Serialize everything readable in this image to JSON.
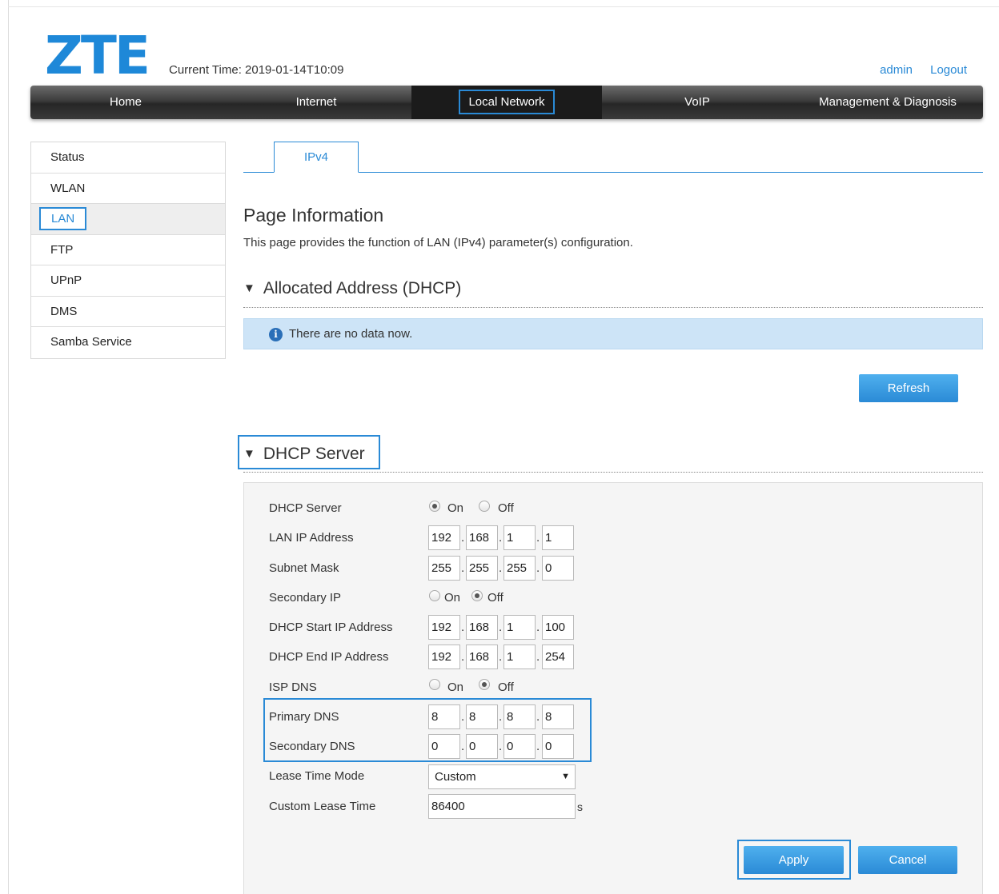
{
  "header": {
    "logo": "ZTE",
    "current_time": "Current Time: 2019-01-14T10:09",
    "user": "admin",
    "logout": "Logout"
  },
  "nav": [
    "Home",
    "Internet",
    "Local Network",
    "VoIP",
    "Management & Diagnosis"
  ],
  "nav_active": "Local Network",
  "sidebar": [
    "Status",
    "WLAN",
    "LAN",
    "FTP",
    "UPnP",
    "DMS",
    "Samba Service"
  ],
  "sidebar_active": "LAN",
  "tab": "IPv4",
  "page": {
    "title": "Page Information",
    "description": "This page provides the function of LAN (IPv4) parameter(s) configuration."
  },
  "allocated": {
    "title": "Allocated Address (DHCP)",
    "info": "There are no data now.",
    "refresh_label": "Refresh"
  },
  "dhcp": {
    "title": "DHCP Server",
    "on_label": "On",
    "off_label": "Off",
    "fields": {
      "server": {
        "label": "DHCP Server",
        "value": "On"
      },
      "lan_ip": {
        "label": "LAN IP Address",
        "octets": [
          "192",
          "168",
          "1",
          "1"
        ]
      },
      "subnet": {
        "label": "Subnet Mask",
        "octets": [
          "255",
          "255",
          "255",
          "0"
        ]
      },
      "secondary_ip": {
        "label": "Secondary IP",
        "value": "Off"
      },
      "start_ip": {
        "label": "DHCP Start IP Address",
        "octets": [
          "192",
          "168",
          "1",
          "100"
        ]
      },
      "end_ip": {
        "label": "DHCP End IP Address",
        "octets": [
          "192",
          "168",
          "1",
          "254"
        ]
      },
      "isp_dns": {
        "label": "ISP DNS",
        "value": "Off"
      },
      "primary_dns": {
        "label": "Primary DNS",
        "octets": [
          "8",
          "8",
          "8",
          "8"
        ]
      },
      "secondary_dns": {
        "label": "Secondary DNS",
        "octets": [
          "0",
          "0",
          "0",
          "0"
        ]
      },
      "lease_mode": {
        "label": "Lease Time Mode",
        "value": "Custom"
      },
      "custom_lease": {
        "label": "Custom Lease Time",
        "value": "86400",
        "unit": "s"
      }
    },
    "apply_label": "Apply",
    "cancel_label": "Cancel"
  },
  "colors": {
    "accent": "#2a8ad6",
    "info_bg": "#cde4f7",
    "nav_dark": "#262626"
  }
}
